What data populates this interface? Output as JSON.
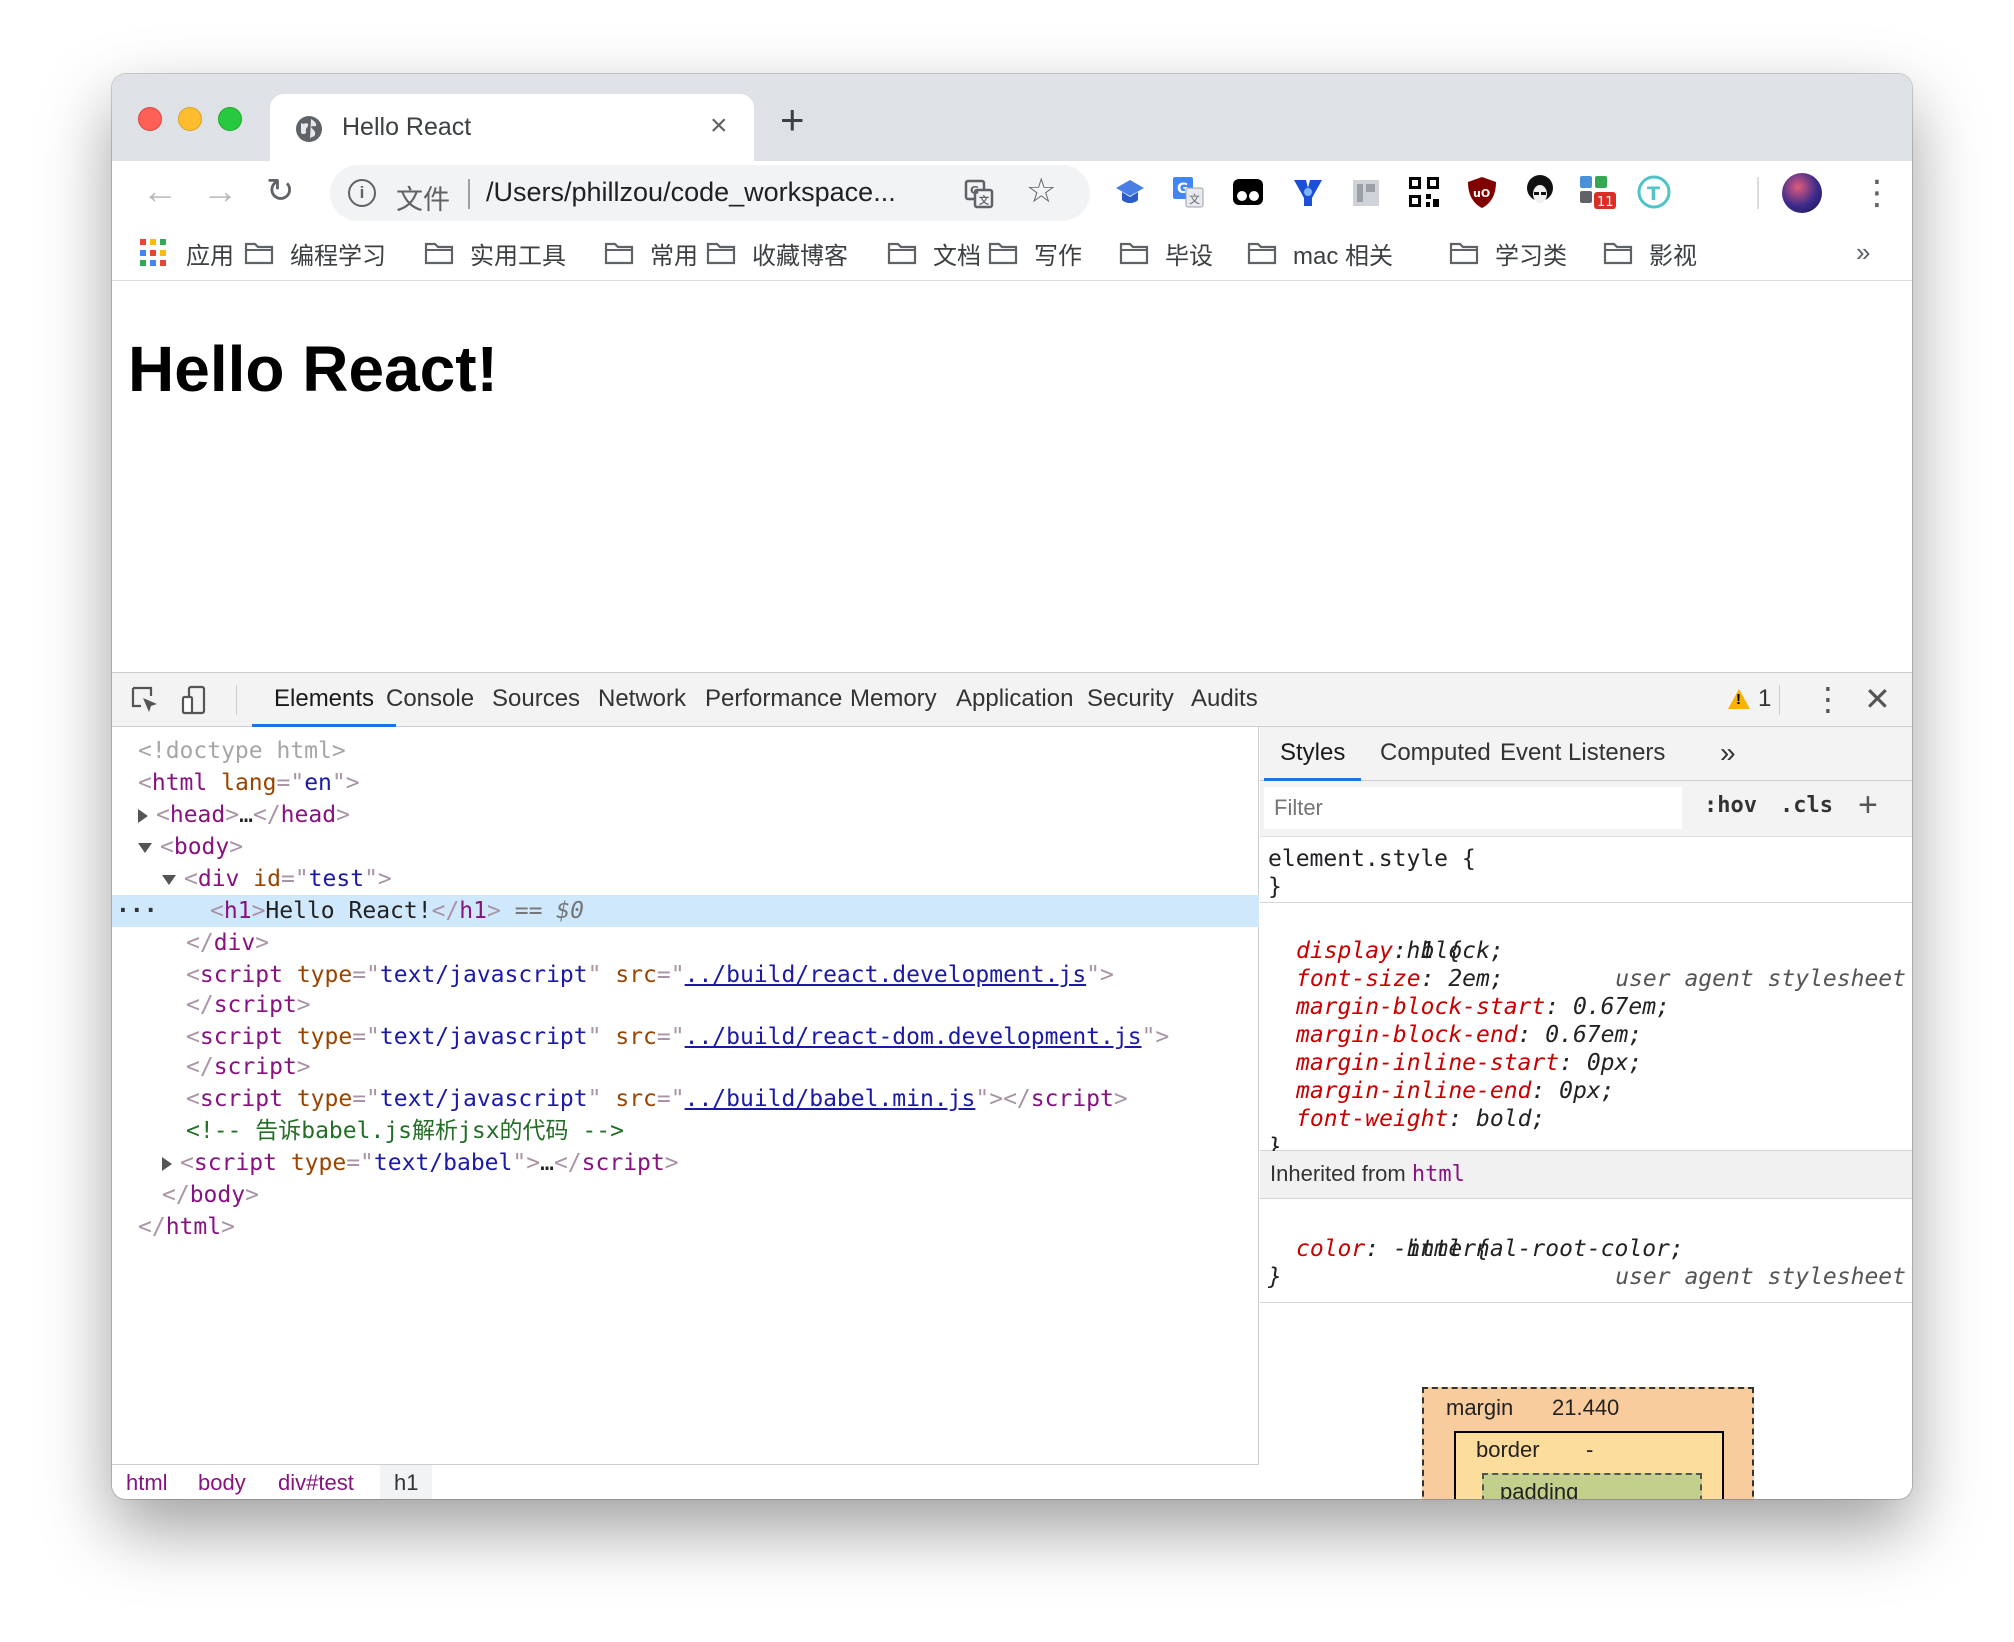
{
  "tab": {
    "title": "Hello React"
  },
  "omnibox": {
    "scheme_label": "文件",
    "url": "/Users/phillzou/code_workspace..."
  },
  "extensions": {
    "badge_count": "11"
  },
  "bookmarks": {
    "apps_label": "应用",
    "folders": [
      "编程学习",
      "实用工具",
      "常用",
      "收藏博客",
      "文档",
      "写作",
      "毕设",
      "mac 相关",
      "学习类",
      "影视"
    ],
    "more": "»"
  },
  "page": {
    "heading": "Hello React!"
  },
  "devtools": {
    "tabs": [
      "Elements",
      "Console",
      "Sources",
      "Network",
      "Performance",
      "Memory",
      "Application",
      "Security",
      "Audits"
    ],
    "active_tab": "Elements",
    "warning_count": "1",
    "dom": {
      "doctype": "<!doctype html>",
      "html_open_tag": "html",
      "lang_attr": "lang",
      "lang_val": "en",
      "head_tag": "head",
      "head_ellipsis": "…",
      "body_tag": "body",
      "div_tag": "div",
      "div_attr": "id",
      "div_id": "test",
      "h1_tag": "h1",
      "h1_text": "Hello React!",
      "h1_marker": "== $0",
      "script_tag": "script",
      "type_attr": "type",
      "src_attr": "src",
      "type_js": "text/javascript",
      "type_babel": "text/babel",
      "src_react": "../build/react.development.js",
      "src_react_dom": "../build/react-dom.development.js",
      "src_babel": "../build/babel.min.js",
      "comment": "<!-- 告诉babel.js解析jsx的代码 -->",
      "ellipsis": "…"
    },
    "breadcrumbs": [
      "html",
      "body",
      "div#test",
      "h1"
    ],
    "styles": {
      "tabs": [
        "Styles",
        "Computed",
        "Event Listeners"
      ],
      "more": "»",
      "filter_placeholder": "Filter",
      "hov": ":hov",
      "cls": ".cls",
      "add": "+",
      "element_style_selector": "element.style {",
      "close_brace": "}",
      "h1_selector": "h1 {",
      "ua_source": "user agent stylesheet",
      "h1_props": [
        {
          "name": "display",
          "value": "block;"
        },
        {
          "name": "font-size",
          "value": "2em;"
        },
        {
          "name": "margin-block-start",
          "value": "0.67em;"
        },
        {
          "name": "margin-block-end",
          "value": "0.67em;"
        },
        {
          "name": "margin-inline-start",
          "value": "0px;"
        },
        {
          "name": "margin-inline-end",
          "value": "0px;"
        },
        {
          "name": "font-weight",
          "value": "bold;"
        }
      ],
      "inherited_label": "Inherited from",
      "inherited_tag": "html",
      "html_selector": "html {",
      "html_props": [
        {
          "name": "color",
          "value": "-internal-root-color;"
        }
      ]
    },
    "box_model": {
      "margin_label": "margin",
      "margin_value": "21.440",
      "border_label": "border",
      "border_value": "-",
      "padding_label": "padding"
    }
  }
}
